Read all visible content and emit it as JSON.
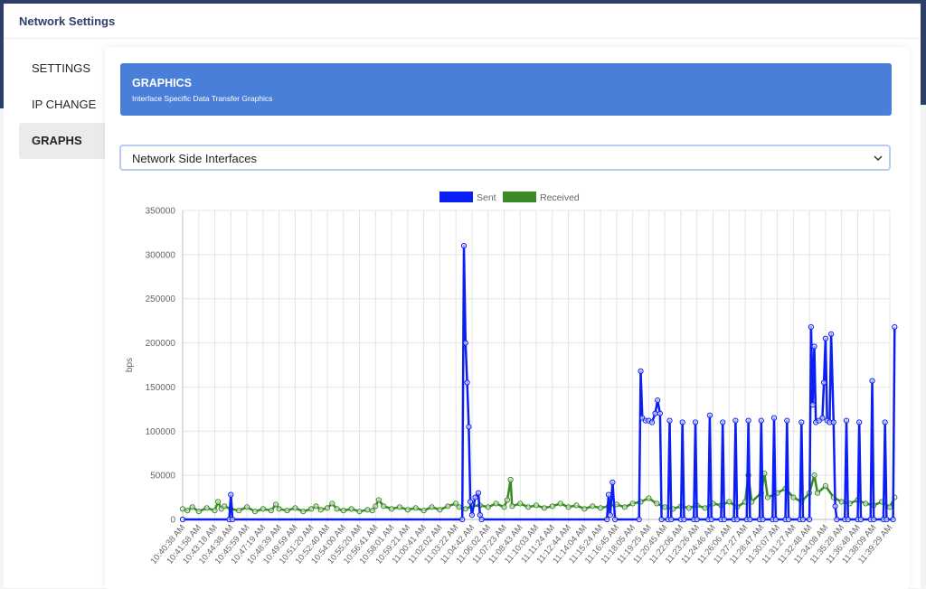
{
  "app": {
    "title": "Network Settings"
  },
  "sidebar": {
    "items": [
      {
        "label": "SETTINGS",
        "active": false
      },
      {
        "label": "IP CHANGE",
        "active": false
      },
      {
        "label": "GRAPHS",
        "active": true
      }
    ]
  },
  "banner": {
    "title": "GRAPHICS",
    "subtitle": "Interface Specific Data Transfer Graphics",
    "color": "#4a7fd9"
  },
  "interface_select": {
    "value": "Network Side Interfaces",
    "icon": "chevron-down-icon"
  },
  "chart_data": {
    "type": "line",
    "ylabel": "bps",
    "ylim": [
      0,
      350000
    ],
    "yticks": [
      0,
      50000,
      100000,
      150000,
      200000,
      250000,
      300000,
      350000
    ],
    "grid": true,
    "legend_position": "top-center",
    "x_tick_labels": [
      "10:40:38 AM",
      "10:41:58 AM",
      "10:43:18 AM",
      "10:44:38 AM",
      "10:45:59 AM",
      "10:47:19 AM",
      "10:48:39 AM",
      "10:49:59 AM",
      "10:51:20 AM",
      "10:52:40 AM",
      "10:54:00 AM",
      "10:55:20 AM",
      "10:56:41 AM",
      "10:58:01 AM",
      "10:59:21 AM",
      "11:00:41 AM",
      "11:02:02 AM",
      "11:03:22 AM",
      "11:04:42 AM",
      "11:06:02 AM",
      "11:07:23 AM",
      "11:08:43 AM",
      "11:10:03 AM",
      "11:11:24 AM",
      "11:12:44 AM",
      "11:14:04 AM",
      "11:15:24 AM",
      "11:16:45 AM",
      "11:18:05 AM",
      "11:19:25 AM",
      "11:20:45 AM",
      "11:22:06 AM",
      "11:23:26 AM",
      "11:24:46 AM",
      "11:26:06 AM",
      "11:27:27 AM",
      "11:28:47 AM",
      "11:30:07 AM",
      "11:31:27 AM",
      "11:32:48 AM",
      "11:34:08 AM",
      "11:35:28 AM",
      "11:36:48 AM",
      "11:38:09 AM",
      "11:39:29 AM"
    ],
    "series": [
      {
        "name": "Sent",
        "color": "#0a1ef5",
        "points": [
          [
            0,
            0
          ],
          [
            2.9,
            0
          ],
          [
            3,
            28000
          ],
          [
            3.1,
            0
          ],
          [
            17.4,
            0
          ],
          [
            17.5,
            310000
          ],
          [
            17.6,
            200000
          ],
          [
            17.7,
            155000
          ],
          [
            17.8,
            105000
          ],
          [
            17.9,
            20000
          ],
          [
            18,
            5000
          ],
          [
            18.2,
            25000
          ],
          [
            18.4,
            30000
          ],
          [
            18.5,
            5000
          ],
          [
            18.6,
            0
          ],
          [
            26.4,
            0
          ],
          [
            26.5,
            28000
          ],
          [
            26.6,
            5000
          ],
          [
            26.75,
            42000
          ],
          [
            26.9,
            0
          ],
          [
            28.4,
            0
          ],
          [
            28.5,
            168000
          ],
          [
            28.6,
            115000
          ],
          [
            28.8,
            112000
          ],
          [
            29,
            112000
          ],
          [
            29.2,
            110000
          ],
          [
            29.4,
            120000
          ],
          [
            29.55,
            135000
          ],
          [
            29.7,
            120000
          ],
          [
            29.8,
            0
          ],
          [
            30.2,
            0
          ],
          [
            30.3,
            112000
          ],
          [
            30.4,
            0
          ],
          [
            31,
            0
          ],
          [
            31.1,
            110000
          ],
          [
            31.2,
            0
          ],
          [
            31.8,
            0
          ],
          [
            31.9,
            110000
          ],
          [
            32,
            0
          ],
          [
            32.7,
            0
          ],
          [
            32.8,
            118000
          ],
          [
            32.9,
            0
          ],
          [
            33.5,
            0
          ],
          [
            33.6,
            110000
          ],
          [
            33.7,
            0
          ],
          [
            34.3,
            0
          ],
          [
            34.4,
            112000
          ],
          [
            34.5,
            0
          ],
          [
            35.1,
            0
          ],
          [
            35.2,
            112000
          ],
          [
            35.3,
            0
          ],
          [
            35.9,
            0
          ],
          [
            36,
            112000
          ],
          [
            36.1,
            0
          ],
          [
            36.7,
            0
          ],
          [
            36.8,
            115000
          ],
          [
            36.9,
            0
          ],
          [
            37.5,
            0
          ],
          [
            37.6,
            112000
          ],
          [
            37.7,
            0
          ],
          [
            38.4,
            0
          ],
          [
            38.5,
            110000
          ],
          [
            38.6,
            0
          ],
          [
            39,
            0
          ],
          [
            39.1,
            218000
          ],
          [
            39.2,
            130000
          ],
          [
            39.3,
            196000
          ],
          [
            39.4,
            110000
          ],
          [
            39.6,
            112000
          ],
          [
            39.8,
            115000
          ],
          [
            39.9,
            155000
          ],
          [
            40,
            205000
          ],
          [
            40.1,
            112000
          ],
          [
            40.25,
            110000
          ],
          [
            40.35,
            210000
          ],
          [
            40.5,
            110000
          ],
          [
            40.6,
            15000
          ],
          [
            40.7,
            0
          ],
          [
            41.2,
            0
          ],
          [
            41.3,
            112000
          ],
          [
            41.4,
            0
          ],
          [
            42,
            0
          ],
          [
            42.1,
            110000
          ],
          [
            42.2,
            0
          ],
          [
            42.8,
            0
          ],
          [
            42.9,
            157000
          ],
          [
            43,
            0
          ],
          [
            43.6,
            0
          ],
          [
            43.7,
            110000
          ],
          [
            43.8,
            0
          ],
          [
            44.2,
            0
          ],
          [
            44.3,
            218000
          ]
        ]
      },
      {
        "name": "Received",
        "color": "#3a8a26",
        "points": [
          [
            0,
            12000
          ],
          [
            0.3,
            10000
          ],
          [
            0.6,
            14000
          ],
          [
            1,
            9000
          ],
          [
            1.5,
            13000
          ],
          [
            2,
            10000
          ],
          [
            2.2,
            20000
          ],
          [
            2.4,
            12000
          ],
          [
            2.6,
            15000
          ],
          [
            3,
            12000
          ],
          [
            3.5,
            10000
          ],
          [
            4,
            14000
          ],
          [
            4.5,
            9000
          ],
          [
            5,
            12000
          ],
          [
            5.5,
            10000
          ],
          [
            5.8,
            17000
          ],
          [
            6,
            12000
          ],
          [
            6.5,
            10000
          ],
          [
            7,
            13000
          ],
          [
            7.5,
            9000
          ],
          [
            8,
            12000
          ],
          [
            8.3,
            15000
          ],
          [
            8.6,
            11000
          ],
          [
            9,
            13000
          ],
          [
            9.3,
            18000
          ],
          [
            9.6,
            12000
          ],
          [
            10,
            10000
          ],
          [
            10.5,
            12000
          ],
          [
            11,
            9000
          ],
          [
            11.5,
            11000
          ],
          [
            11.8,
            10000
          ],
          [
            12,
            15000
          ],
          [
            12.2,
            22000
          ],
          [
            12.5,
            15000
          ],
          [
            13,
            12000
          ],
          [
            13.5,
            14000
          ],
          [
            14,
            11000
          ],
          [
            14.5,
            13000
          ],
          [
            15,
            10000
          ],
          [
            15.5,
            14000
          ],
          [
            16,
            11000
          ],
          [
            16.5,
            15000
          ],
          [
            17,
            18000
          ],
          [
            17.2,
            14000
          ],
          [
            17.6,
            12000
          ],
          [
            18,
            15000
          ],
          [
            18.5,
            16000
          ],
          [
            19,
            14000
          ],
          [
            19.5,
            18000
          ],
          [
            20,
            14000
          ],
          [
            20.2,
            22000
          ],
          [
            20.4,
            45000
          ],
          [
            20.5,
            15000
          ],
          [
            21,
            18000
          ],
          [
            21.5,
            14000
          ],
          [
            22,
            16000
          ],
          [
            22.5,
            13000
          ],
          [
            23,
            15000
          ],
          [
            23.5,
            18000
          ],
          [
            24,
            14000
          ],
          [
            24.5,
            16000
          ],
          [
            25,
            12000
          ],
          [
            25.5,
            15000
          ],
          [
            26,
            13000
          ],
          [
            26.5,
            15000
          ],
          [
            27,
            17000
          ],
          [
            27.5,
            14000
          ],
          [
            28,
            18000
          ],
          [
            28.5,
            20000
          ],
          [
            29,
            24000
          ],
          [
            29.5,
            18000
          ],
          [
            30,
            14000
          ],
          [
            30.5,
            12000
          ],
          [
            31,
            15000
          ],
          [
            31.5,
            13000
          ],
          [
            32,
            16000
          ],
          [
            32.5,
            13000
          ],
          [
            33,
            18000
          ],
          [
            33.5,
            16000
          ],
          [
            34,
            20000
          ],
          [
            34.5,
            14000
          ],
          [
            35,
            20000
          ],
          [
            35.2,
            50000
          ],
          [
            35.4,
            20000
          ],
          [
            36,
            30000
          ],
          [
            36.2,
            52000
          ],
          [
            36.4,
            25000
          ],
          [
            37,
            30000
          ],
          [
            37.5,
            35000
          ],
          [
            38,
            25000
          ],
          [
            38.5,
            20000
          ],
          [
            39,
            30000
          ],
          [
            39.3,
            50000
          ],
          [
            39.5,
            30000
          ],
          [
            40,
            38000
          ],
          [
            40.5,
            25000
          ],
          [
            41,
            20000
          ],
          [
            41.5,
            18000
          ],
          [
            42,
            22000
          ],
          [
            42.5,
            18000
          ],
          [
            43,
            16000
          ],
          [
            43.5,
            20000
          ],
          [
            44,
            14000
          ],
          [
            44.3,
            25000
          ]
        ]
      }
    ]
  }
}
